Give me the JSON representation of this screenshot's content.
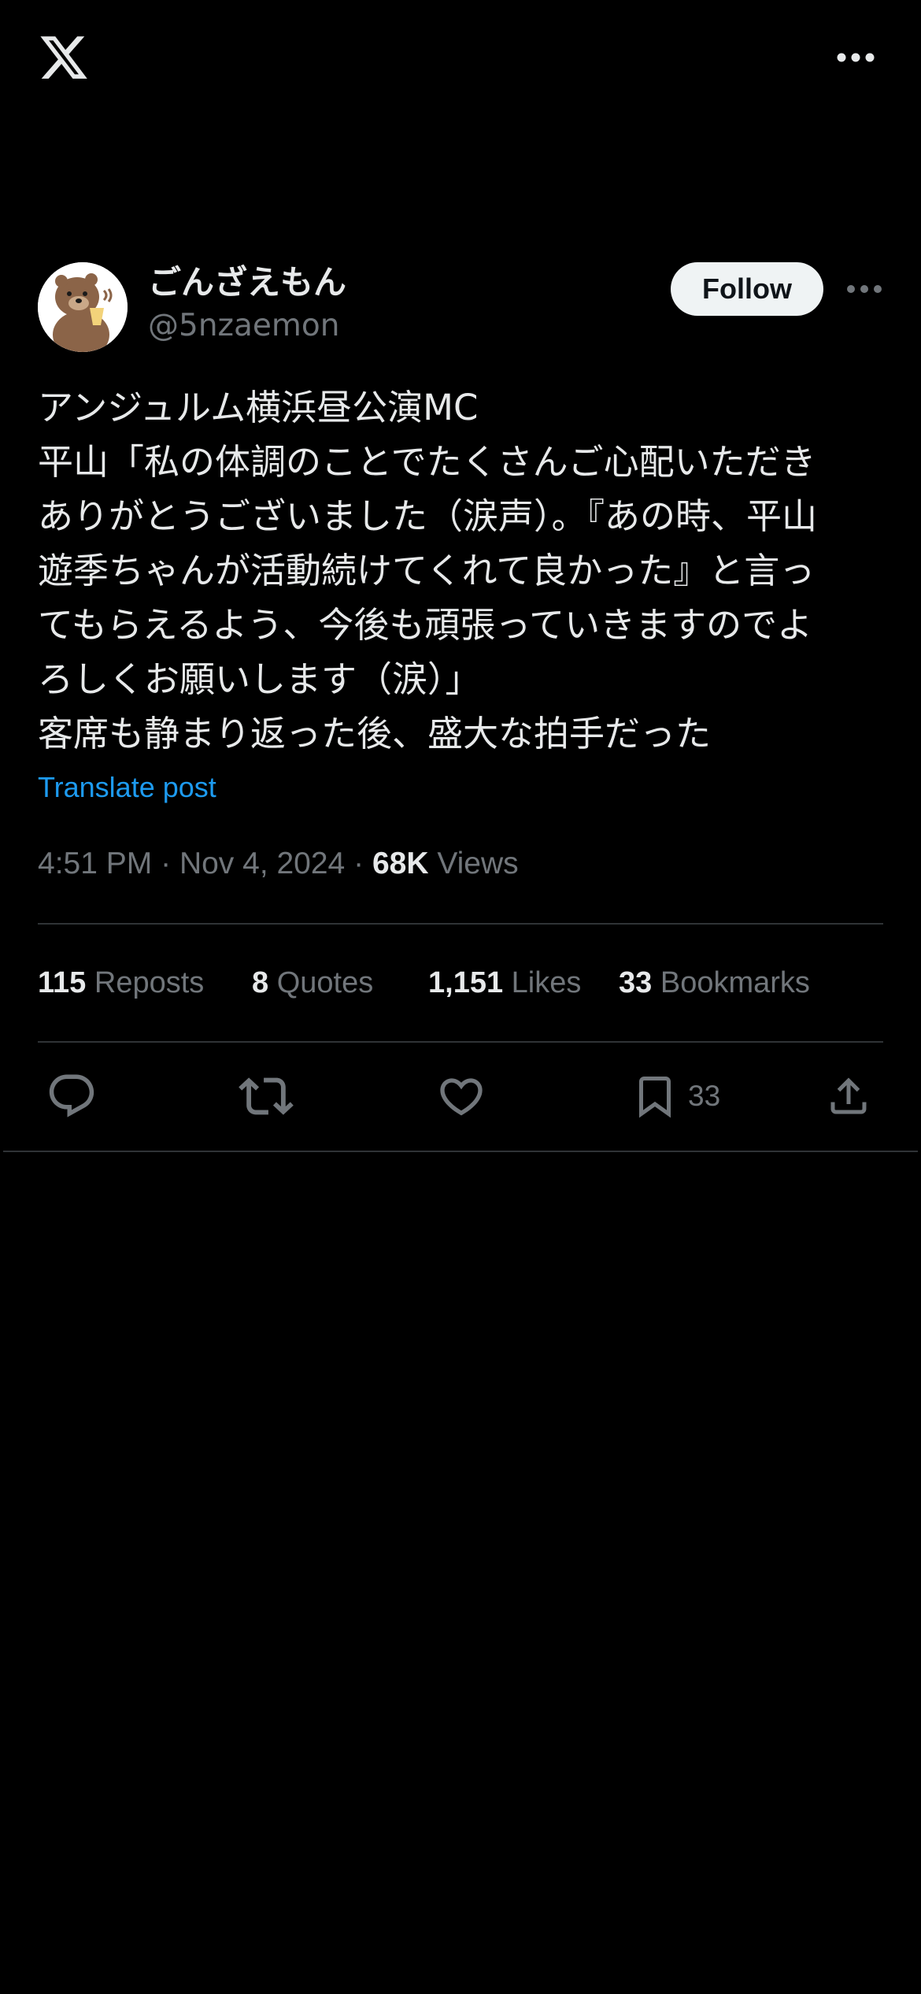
{
  "author": {
    "name": "ごんざえもん",
    "handle": "@5nzaemon",
    "follow_label": "Follow"
  },
  "tweet": {
    "lines": [
      "アンジュルム横浜昼公演MC",
      "平山「私の体調のことでたくさんご心配いただき",
      "ありがとうございました（涙声）。『あの時、平山",
      "遊季ちゃんが活動続けてくれて良かった』と言っ",
      "てもらえるよう、今後も頑張っていきますのでよ",
      "ろしくお願いします（涙）」",
      "客席も静まり返った後、盛大な拍手だった"
    ],
    "translate_label": "Translate post"
  },
  "meta": {
    "time": "4:51 PM",
    "separator": "·",
    "date": "Nov 4, 2024",
    "views_count": "68K",
    "views_label": "Views"
  },
  "stats": {
    "reposts": {
      "count": "115",
      "label": "Reposts"
    },
    "quotes": {
      "count": "8",
      "label": "Quotes"
    },
    "likes": {
      "count": "1,151",
      "label": "Likes"
    },
    "bookmarks": {
      "count": "33",
      "label": "Bookmarks"
    }
  },
  "actions": {
    "bookmark_count": "33",
    "icons": [
      "reply-icon",
      "repost-icon",
      "like-icon",
      "bookmark-icon",
      "share-icon"
    ]
  },
  "colors": {
    "background": "#000000",
    "text": "#e7e9ea",
    "muted": "#71767b",
    "link": "#1d9bf0",
    "divider": "#2f3336",
    "follow_bg": "#eff3f4"
  }
}
